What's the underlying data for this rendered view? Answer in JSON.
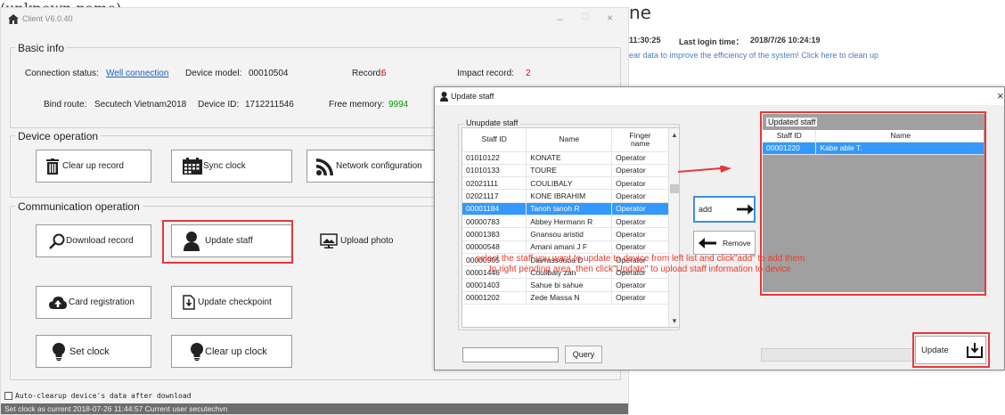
{
  "top_fragment": "(unknown name)",
  "main_window": {
    "title": "Client V6.0.40",
    "min": "–",
    "max": "☐",
    "close": "×",
    "basic_info": {
      "title": "Basic info",
      "connection_status_label": "Connection status:",
      "connection_status_value": "Well connection",
      "device_model_label": "Device model:",
      "device_model_value": "00010504",
      "record_label": "Record:",
      "record_value": "6",
      "impact_record_label": "Impact record:",
      "impact_record_value": "2",
      "bind_route_label": "Bind route:",
      "bind_route_value": "Secutech Vietnam2018",
      "device_id_label": "Device ID:",
      "device_id_value": "1712211546",
      "free_memory_label": "Free memory:",
      "free_memory_value": "9994"
    },
    "device_operation": {
      "title": "Device operation",
      "clear_up_record": "Clear up record",
      "sync_clock": "Sync clock",
      "network_configuration": "Network configuration"
    },
    "communication_operation": {
      "title": "Communication operation",
      "download_record": "Download record",
      "update_staff": "Update staff",
      "upload_photo": "Upload photo",
      "card_registration": "Card registration",
      "update_checkpoint": "Update checkpoint",
      "set_clock": "Set clock",
      "clear_up_clock": "Clear up clock"
    },
    "auto_clearup": "Auto-clearup device's data after download",
    "status_bar": "Set clock as current  2018-07-26 11:44:57   Current user  secutechvn"
  },
  "background_right": {
    "heading_fragment": "ne",
    "time_fragment": "11:30:25",
    "last_login_label": "Last login time：",
    "last_login_value": "2018/7/26 10:24:19",
    "cleanup_message": "ear data to improve the efficiency of the system! Click here to clean up"
  },
  "dialog": {
    "title": "Update staff",
    "close": "×",
    "unupdate": {
      "title": "Unupdate staff",
      "columns": [
        "Staff ID",
        "Name",
        "Finger\nname"
      ],
      "rows": [
        [
          "01010122",
          "KONATE",
          "Operator"
        ],
        [
          "01010133",
          "TOURE",
          "Operator"
        ],
        [
          "02021111",
          "COULIBALY",
          "Operator"
        ],
        [
          "02021117",
          "KONE IBRAHIM",
          "Operator"
        ],
        [
          "00001184",
          "Tanoh tanoh R",
          "Operator"
        ],
        [
          "00000783",
          "Abbey Hermann R",
          "Operator"
        ],
        [
          "00001383",
          "Gnansou aristid",
          "Operator"
        ],
        [
          "00000548",
          "Amani amani J F",
          "Operator"
        ],
        [
          "00000905",
          "Diarrassouba D",
          "Operator"
        ],
        [
          "00001446",
          "Coulibaly zan",
          "Operator"
        ],
        [
          "00001403",
          "Sahue bi sahue",
          "Operator"
        ],
        [
          "00001202",
          "Zede Massa N",
          "Operator"
        ]
      ],
      "selected_index": 4
    },
    "add_label": "add",
    "remove_label": "Remove",
    "updated": {
      "title": "Updated staff",
      "columns": [
        "Staff ID",
        "Name"
      ],
      "rows": [
        [
          "00001220",
          "Kabe able T."
        ]
      ],
      "selected_index": 0
    },
    "query_input_value": "",
    "query_label": "Query",
    "update_label": "Update"
  },
  "annotation": {
    "line1": "select the staff you want to update to device from left list and click\"add\" to add them",
    "line2": "In right pending area, then click\"Update\" to upload staff information to device"
  },
  "colors": {
    "highlight": "#e4393c",
    "selection": "#3399ff",
    "link": "#1a5fc9",
    "value_red": "#e00000",
    "value_green": "#009900"
  }
}
